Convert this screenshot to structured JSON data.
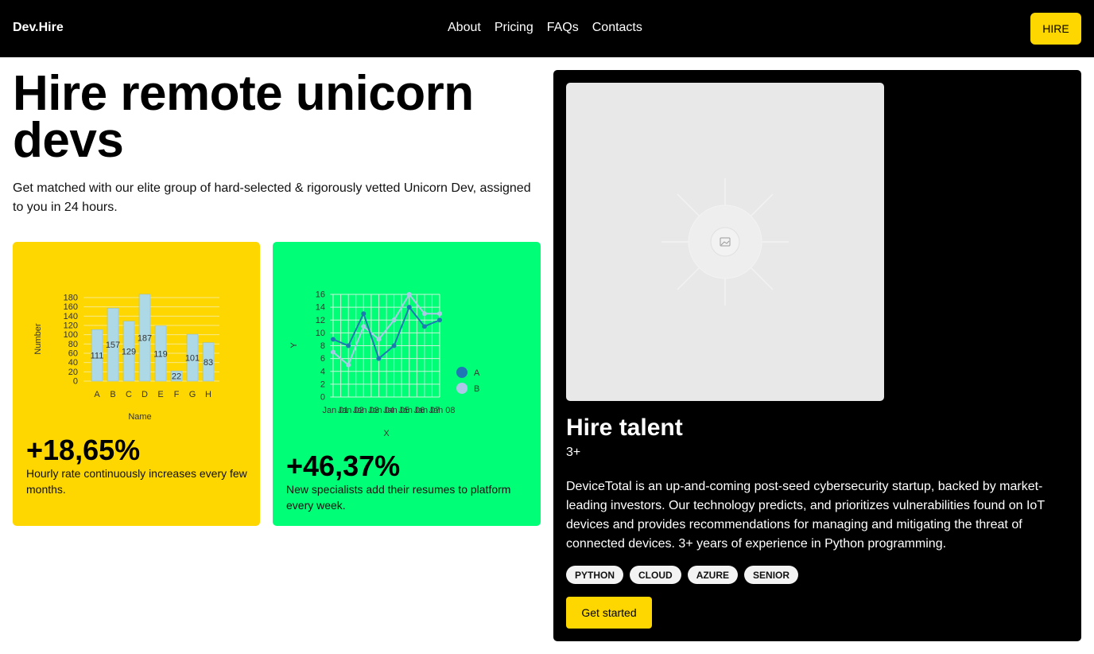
{
  "header": {
    "brand": "Dev.Hire",
    "nav": [
      "About",
      "Pricing",
      "FAQs",
      "Contacts"
    ],
    "cta": "HIRE"
  },
  "hero": {
    "title": "Hire remote unicorn devs",
    "subtitle": "Get matched with our elite group of hard-selected & rigorously vetted Unicorn Dev, assigned to you in 24 hours."
  },
  "stats": [
    {
      "value": "+18,65%",
      "description": "Hourly rate continuously increases every few months.",
      "color": "#fed700"
    },
    {
      "value": "+46,37%",
      "description": "New specialists add their resumes to platform every week.",
      "color": "#00fe77"
    }
  ],
  "talent": {
    "title": "Hire talent",
    "experience": "3+",
    "description": "DeviceTotal is an up-and-coming post-seed cybersecurity startup, backed by market-leading investors. Our technology predicts, and prioritizes vulnerabilities found on IoT devices and provides recommendations for managing and mitigating the threat of connected devices. 3+ years of experience in Python programming.",
    "tags": [
      "PYTHON",
      "CLOUD",
      "AZURE",
      "SENIOR"
    ],
    "cta": "Get started",
    "image_icon": "image-placeholder-icon"
  },
  "chart_data": [
    {
      "type": "bar",
      "categories": [
        "A",
        "B",
        "C",
        "D",
        "E",
        "F",
        "G",
        "H"
      ],
      "values": [
        111,
        157,
        129,
        187,
        119,
        22,
        101,
        83
      ],
      "xlabel": "Name",
      "ylabel": "Number",
      "ylim": [
        0,
        180
      ],
      "yticks": [
        0,
        20,
        40,
        60,
        80,
        100,
        120,
        140,
        160,
        180
      ],
      "grid": true,
      "bar_color": "#add8e6"
    },
    {
      "type": "line",
      "x": [
        "Jan 01",
        "Jan 02",
        "Jan 03",
        "Jan 04",
        "Jan 05",
        "Jan 06",
        "Jan 07",
        "Jan 08"
      ],
      "xtick_labels": [
        "Jan 01",
        "Jan 02",
        "Jan 03",
        "Jan 04",
        "Jan 05",
        "Jan 06",
        "Jan 07",
        "Jan 08"
      ],
      "series": [
        {
          "name": "A",
          "values": [
            9,
            8,
            13,
            6,
            8,
            14,
            11,
            12
          ],
          "color": "#1f77b4"
        },
        {
          "name": "B",
          "values": [
            7,
            5,
            11,
            9,
            12,
            16,
            13,
            13
          ],
          "color": "#aec7e8"
        }
      ],
      "xlabel": "X",
      "ylabel": "Y",
      "ylim": [
        0,
        16
      ],
      "yticks": [
        0,
        2,
        4,
        6,
        8,
        10,
        12,
        14,
        16
      ],
      "grid": true,
      "legend": "right"
    }
  ]
}
